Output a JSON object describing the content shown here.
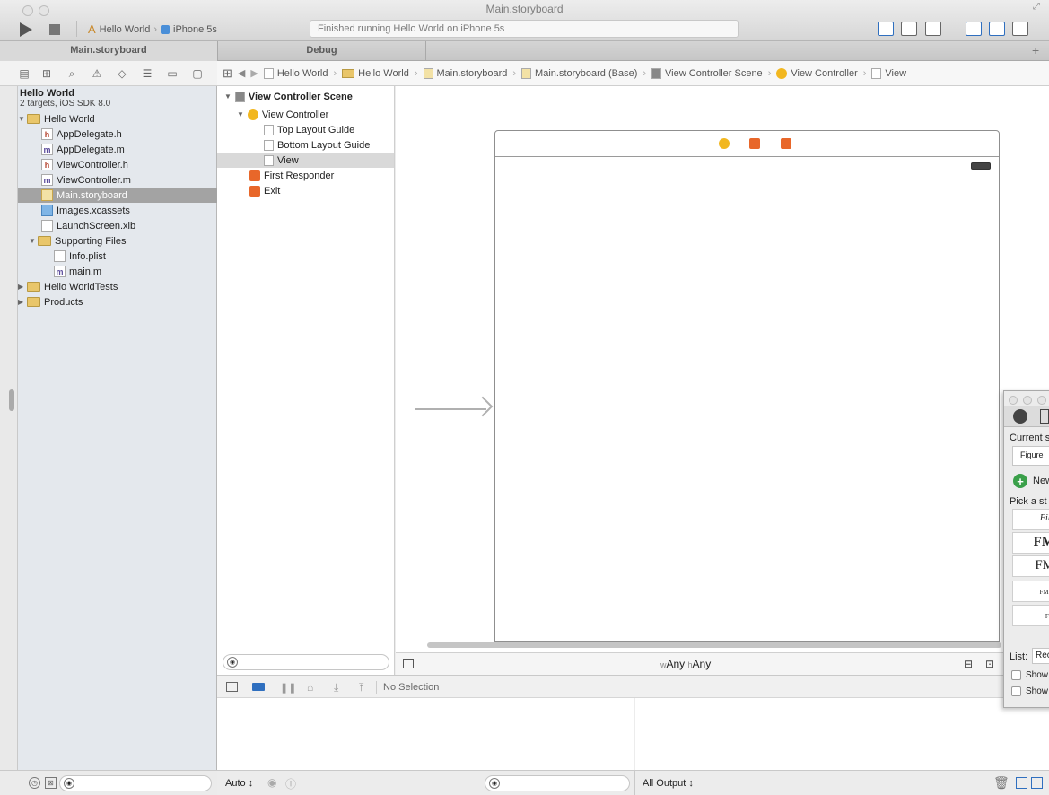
{
  "window": {
    "title": "Main.storyboard"
  },
  "toolbar": {
    "scheme_app": "Hello World",
    "scheme_device": "iPhone 5s",
    "status": "Finished running Hello World on iPhone 5s"
  },
  "tabs": [
    {
      "label": "Main.storyboard"
    },
    {
      "label": "Debug"
    }
  ],
  "navigator": {
    "project": {
      "name": "Hello World",
      "subtitle": "2 targets, iOS SDK 8.0"
    },
    "items": [
      {
        "label": "Hello World",
        "kind": "folder"
      },
      {
        "label": "AppDelegate.h",
        "kind": "h"
      },
      {
        "label": "AppDelegate.m",
        "kind": "m"
      },
      {
        "label": "ViewController.h",
        "kind": "h"
      },
      {
        "label": "ViewController.m",
        "kind": "m"
      },
      {
        "label": "Main.storyboard",
        "kind": "storyboard",
        "selected": true
      },
      {
        "label": "Images.xcassets",
        "kind": "xcassets"
      },
      {
        "label": "LaunchScreen.xib",
        "kind": "xib"
      },
      {
        "label": "Supporting Files",
        "kind": "folder"
      },
      {
        "label": "Info.plist",
        "kind": "plist"
      },
      {
        "label": "main.m",
        "kind": "m"
      },
      {
        "label": "Hello WorldTests",
        "kind": "folder"
      },
      {
        "label": "Products",
        "kind": "folder"
      }
    ]
  },
  "jumpbar": {
    "crumbs": [
      "Hello World",
      "Hello World",
      "Main.storyboard",
      "Main.storyboard (Base)",
      "View Controller Scene",
      "View Controller",
      "View"
    ]
  },
  "outline": {
    "scene": "View Controller Scene",
    "items": [
      {
        "label": "View Controller"
      },
      {
        "label": "Top Layout Guide"
      },
      {
        "label": "Bottom Layout Guide"
      },
      {
        "label": "View",
        "selected": true
      },
      {
        "label": "First Responder"
      },
      {
        "label": "Exit"
      }
    ]
  },
  "canvas": {
    "size_class": {
      "w_prefix": "w",
      "w_value": "Any",
      "h_prefix": "h",
      "h_value": "Any"
    }
  },
  "debug": {
    "selection": "No Selection",
    "auto_label": "Auto",
    "output_label": "All Output"
  },
  "styles_panel": {
    "current_label": "Current s",
    "current_value": "Figure",
    "new_label": "New",
    "pick_label": "Pick a st",
    "samples": [
      "File",
      "FM",
      "FM",
      "FM C",
      "FM"
    ],
    "list_label": "List:",
    "list_value": "Rec",
    "show1": "Show",
    "show2": "Show"
  },
  "colors": {
    "accent": "#2f6fbf",
    "selection": "#a3a3a3",
    "folder": "#e9c66a",
    "vc_icon": "#f2b71f",
    "responder_icon": "#e8672a"
  }
}
